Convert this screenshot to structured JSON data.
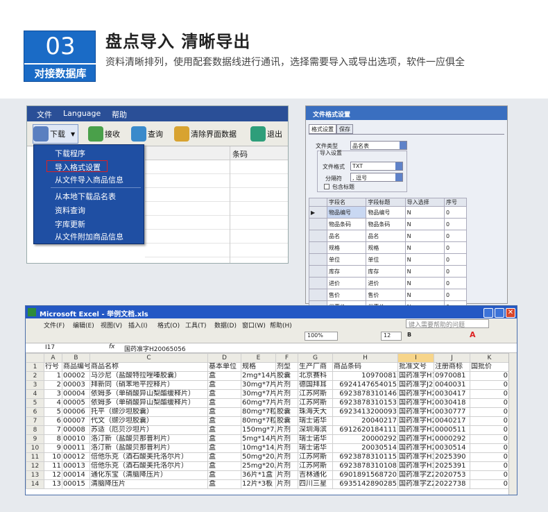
{
  "header": {
    "number": "03",
    "badge_label": "对接数据库",
    "title": "盘点导入  清晰导出",
    "description": "资料清晰排列，使用配套数据线进行通讯，选择需要导入或导出选项，软件一应俱全"
  },
  "app1": {
    "menu": [
      "文件",
      "Language",
      "帮助"
    ],
    "toolbar": [
      "下载",
      "接收",
      "查询",
      "清除界面数据",
      "退出"
    ],
    "grid_header": "条码",
    "dropdown": [
      "下载程序",
      "导入格式设置",
      "从文件导入商品信息",
      "从本地下载品名表",
      "资料查询",
      "字库更新",
      "从文件附加商品信息"
    ]
  },
  "dialog": {
    "title": "文件格式设置",
    "tabs": [
      "格式设置",
      "保存"
    ],
    "file_type_label": "文件类型",
    "file_type_value": "品名表",
    "import_group": "导入设置",
    "format_label": "文件格式",
    "format_value": "TXT",
    "separator_label": "分隔符",
    "separator_value": ", 逗号",
    "include_header": "包含标题",
    "table_headers": [
      "字段名",
      "字段标题",
      "导入选择",
      "序号"
    ],
    "rows": [
      [
        "物品编号",
        "物品编号",
        "N",
        "0"
      ],
      [
        "物品条码",
        "物品条码",
        "N",
        "0"
      ],
      [
        "品名",
        "品名",
        "N",
        "0"
      ],
      [
        "规格",
        "规格",
        "N",
        "0"
      ],
      [
        "单位",
        "单位",
        "N",
        "0"
      ],
      [
        "库存",
        "库存",
        "N",
        "0"
      ],
      [
        "进价",
        "进价",
        "N",
        "0"
      ],
      [
        "售价",
        "售价",
        "N",
        "0"
      ],
      [
        "优惠价",
        "优惠价",
        "N",
        "0"
      ]
    ]
  },
  "excel": {
    "title": "Microsoft Excel - 举例文档.xls",
    "menu": [
      "文件(F)",
      "编辑(E)",
      "视图(V)",
      "插入(I)",
      "格式(O)",
      "工具(T)",
      "数据(D)",
      "窗口(W)",
      "帮助(H)"
    ],
    "help_placeholder": "键入需要帮助的问题",
    "zoom": "100%",
    "font_size": "12",
    "cell_ref": "I17",
    "formula": "国药准字H20065056",
    "columns": [
      "A",
      "B",
      "C",
      "D",
      "E",
      "F",
      "G",
      "H",
      "I",
      "J",
      "K"
    ],
    "rows": [
      [
        "1",
        "行号",
        "商品编号",
        "商品名称",
        "基本单位",
        "规格",
        "剂型",
        "生产厂商",
        "商品条码",
        "批准文号",
        "注册商标",
        "国批价"
      ],
      [
        "2",
        "1",
        "00002",
        "马沙尼（盐酸特拉唑嗪胶囊）",
        "盒",
        "2mg*14片*1",
        "胶囊",
        "北京赛科",
        "10970081",
        "国药准字H1",
        "0970081",
        "0"
      ],
      [
        "3",
        "2",
        "00003",
        "拜新同（硝苯地平控释片）",
        "盒",
        "30mg*7片",
        "片剂",
        "德国拜耳",
        "6924147654015",
        "国药准字J2",
        "0040031",
        "0"
      ],
      [
        "4",
        "3",
        "00004",
        "依姆多（单硝酸异山梨酯缓释片）",
        "盒",
        "30mg*7片",
        "片剂",
        "江苏阿斯",
        "6923878310146",
        "国药准字H2",
        "0030417",
        "0"
      ],
      [
        "5",
        "4",
        "00005",
        "依姆多（单硝酸异山梨酯缓释片）",
        "盒",
        "60mg*7片",
        "片剂",
        "江苏阿斯",
        "6923878310153",
        "国药准字H2",
        "0030418",
        "0"
      ],
      [
        "6",
        "5",
        "00006",
        "托平（缬沙坦胶囊）",
        "盒",
        "80mg*7粒",
        "胶囊",
        "珠海天大",
        "6923413200093",
        "国药准字H2",
        "0030777",
        "0"
      ],
      [
        "7",
        "6",
        "00007",
        "代文（缬沙坦胶囊）",
        "盒",
        "80mg*7粒",
        "胶囊",
        "瑞士诺华",
        "20040217",
        "国药准字H2",
        "0040217",
        "0"
      ],
      [
        "8",
        "7",
        "00008",
        "苏适（厄贝沙坦片）",
        "盒",
        "150mg*7片",
        "片剂",
        "深圳海滨",
        "6912620184111",
        "国药准字H2",
        "0000511",
        "0"
      ],
      [
        "9",
        "8",
        "00010",
        "洛汀新（盐酸贝那普利片）",
        "盒",
        "5mg*14片",
        "片剂",
        "瑞士诺华",
        "20000292",
        "国药准字H2",
        "0000292",
        "0"
      ],
      [
        "10",
        "9",
        "00011",
        "洛汀新（盐酸贝那普利片）",
        "盒",
        "10mg*14片",
        "片剂",
        "瑞士诺华",
        "20030514",
        "国药准字H2",
        "0030514",
        "0"
      ],
      [
        "11",
        "10",
        "00012",
        "倍他乐克（酒石酸美托洛尔片）",
        "盒",
        "50mg*20片",
        "片剂",
        "江苏阿斯",
        "6923878310115",
        "国药准字H3",
        "2025390",
        "0"
      ],
      [
        "12",
        "11",
        "00013",
        "倍他乐克（酒石酸美托洛尔片）",
        "盒",
        "25mg*20片",
        "片剂",
        "江苏阿斯",
        "6923878310108",
        "国药准字H3",
        "2025391",
        "0"
      ],
      [
        "13",
        "12",
        "00014",
        "通化东宝（清脑降压片）",
        "盒",
        "36片*1盒",
        "片剂",
        "吉林通化",
        "6901891568720",
        "国药准字Z2",
        "2020753",
        "0"
      ],
      [
        "14",
        "13",
        "00015",
        "清脑降压片",
        "盒",
        "12片*3板",
        "片剂",
        "四川三星",
        "6935142890285",
        "国药准字Z2",
        "2022738",
        "0"
      ]
    ]
  }
}
